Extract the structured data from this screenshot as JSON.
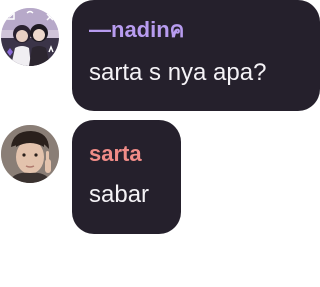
{
  "messages": [
    {
      "author": "—nadinค",
      "text": "sarta s nya apa?",
      "name_color": "#b89cf0",
      "avatar_icon": "user-avatar-nadin"
    },
    {
      "author": "sarta",
      "text": "sabar",
      "name_color": "#f08c88",
      "avatar_icon": "user-avatar-sarta"
    }
  ],
  "colors": {
    "bubble_background": "#25202c",
    "message_text": "#f4f2f6",
    "page_background": "#ffffff"
  }
}
